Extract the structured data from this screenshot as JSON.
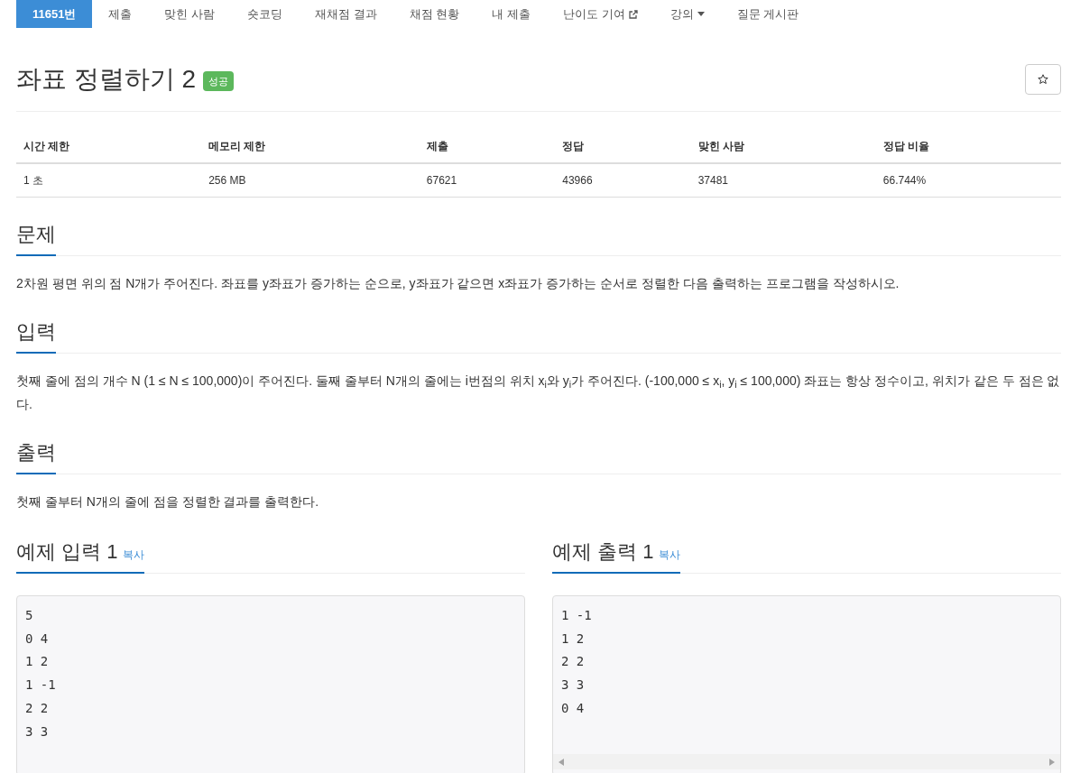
{
  "nav": [
    {
      "label": "11651번",
      "selected": true,
      "kind": "link"
    },
    {
      "label": "제출",
      "selected": false,
      "kind": "link"
    },
    {
      "label": "맞힌 사람",
      "selected": false,
      "kind": "link"
    },
    {
      "label": "숏코딩",
      "selected": false,
      "kind": "link"
    },
    {
      "label": "재채점 결과",
      "selected": false,
      "kind": "link"
    },
    {
      "label": "채점 현황",
      "selected": false,
      "kind": "link"
    },
    {
      "label": "내 제출",
      "selected": false,
      "kind": "link"
    },
    {
      "label": "난이도 기여",
      "selected": false,
      "kind": "external"
    },
    {
      "label": "강의",
      "selected": false,
      "kind": "dropdown"
    },
    {
      "label": "질문 게시판",
      "selected": false,
      "kind": "link"
    }
  ],
  "title": "좌표 정렬하기 2",
  "badge": "성공",
  "starred": false,
  "info_table": {
    "columns": [
      "시간 제한",
      "메모리 제한",
      "제출",
      "정답",
      "맞힌 사람",
      "정답 비율"
    ],
    "rows": [
      [
        "1 초",
        "256 MB",
        "67621",
        "43966",
        "37481",
        "66.744%"
      ]
    ]
  },
  "sections": [
    {
      "heading": "문제",
      "text": "2차원 평면 위의 점 N개가 주어진다. 좌표를 y좌표가 증가하는 순으로, y좌표가 같으면 x좌표가 증가하는 순서로 정렬한 다음 출력하는 프로그램을 작성하시오."
    },
    {
      "heading": "입력",
      "text": "첫째 줄에 점의 개수 N (1 ≤ N ≤ 100,000)이 주어진다. 둘째 줄부터 N개의 줄에는 i번점의 위치 x$_{i}$와 y$_{i}$가 주어진다. (-100,000 ≤ x$_{i}$, y$_{i}$ ≤ 100,000) 좌표는 항상 정수이고, 위치가 같은 두 점은 없다."
    },
    {
      "heading": "출력",
      "text": "첫째 줄부터 N개의 줄에 점을 정렬한 결과를 출력한다."
    }
  ],
  "samples": [
    {
      "heading": "예제 입력 1",
      "copy": "복사",
      "lines": [
        "5",
        "0 4",
        "1 2",
        "1 -1",
        "2 2",
        "3 3"
      ],
      "scrollbar": false
    },
    {
      "heading": "예제 출력 1",
      "copy": "복사",
      "lines": [
        "1 -1",
        "1 2",
        "2 2",
        "3 3",
        "0 4"
      ],
      "scrollbar": true
    }
  ]
}
